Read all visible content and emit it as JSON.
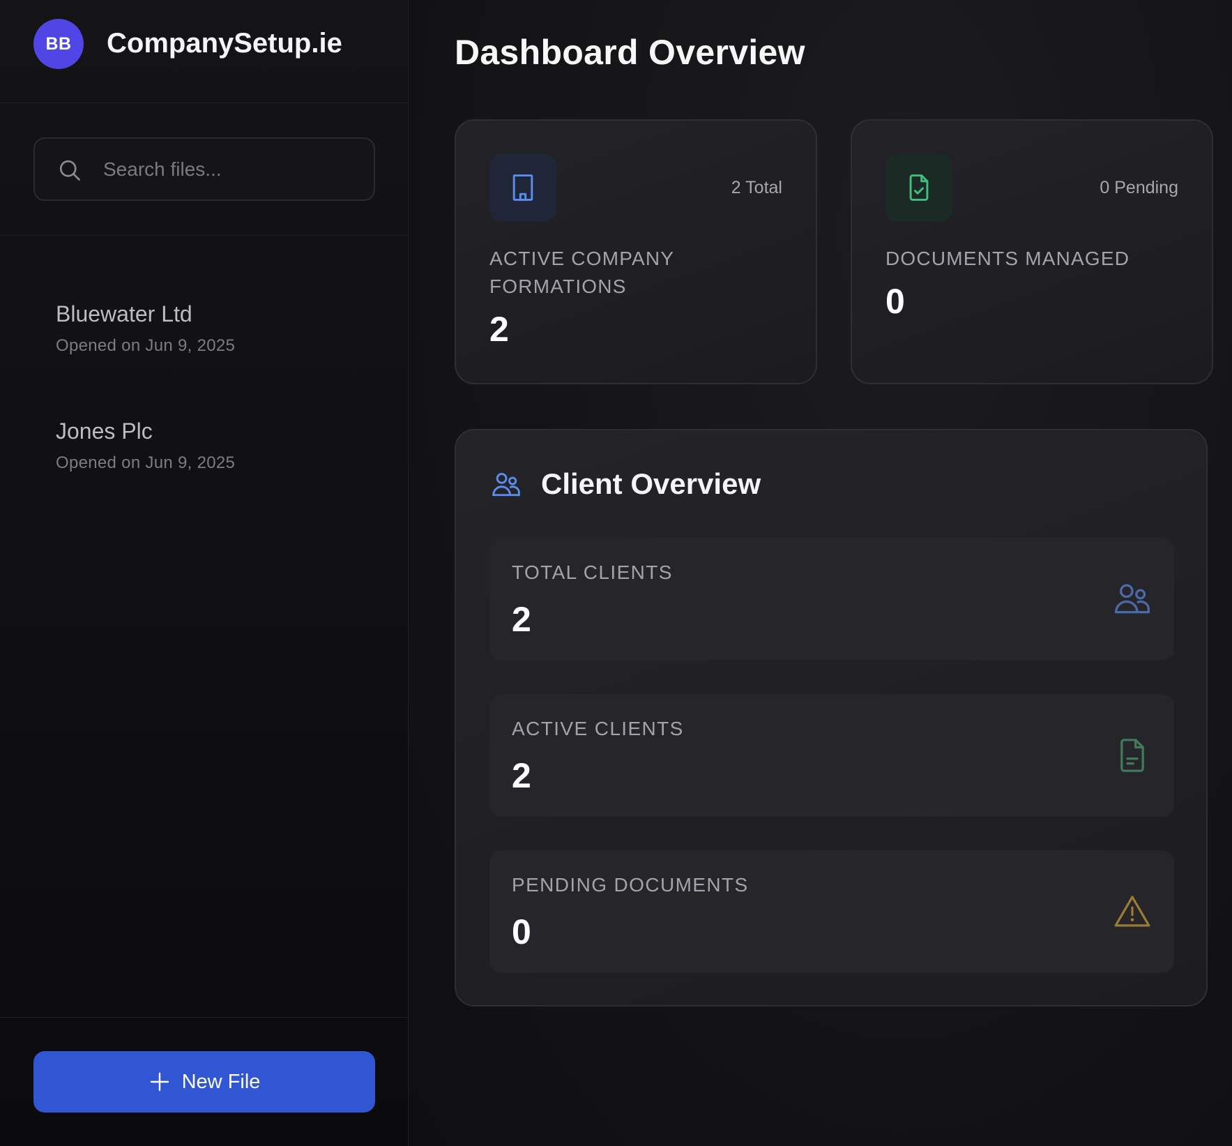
{
  "sidebar": {
    "avatar_initials": "BB",
    "brand": "CompanySetup.ie",
    "search": {
      "placeholder": "Search files...",
      "value": ""
    },
    "files": [
      {
        "name": "Bluewater Ltd",
        "meta": "Opened on Jun 9, 2025"
      },
      {
        "name": "Jones Plc",
        "meta": "Opened on Jun 9, 2025"
      }
    ],
    "new_file_label": "New File"
  },
  "main": {
    "title": "Dashboard Overview",
    "stats": [
      {
        "icon": "building-icon",
        "badge": "2 Total",
        "label": "ACTIVE COMPANY FORMATIONS",
        "value": "2",
        "accent": "#5b8def"
      },
      {
        "icon": "document-check-icon",
        "badge": "0 Pending",
        "label": "DOCUMENTS MANAGED",
        "value": "0",
        "accent": "#3fbf7f"
      }
    ],
    "client_overview": {
      "title": "Client Overview",
      "icon": "users-icon",
      "metrics": [
        {
          "label": "TOTAL CLIENTS",
          "value": "2",
          "icon": "users-icon",
          "color": "#4a6aa8"
        },
        {
          "label": "ACTIVE CLIENTS",
          "value": "2",
          "icon": "document-icon",
          "color": "#3f7a5c"
        },
        {
          "label": "PENDING DOCUMENTS",
          "value": "0",
          "icon": "warning-icon",
          "color": "#9a7a34"
        }
      ]
    }
  },
  "colors": {
    "avatar": "#4f46e5",
    "primary_button": "#3056d3",
    "background": "#121214",
    "card": "#1f1f23"
  }
}
